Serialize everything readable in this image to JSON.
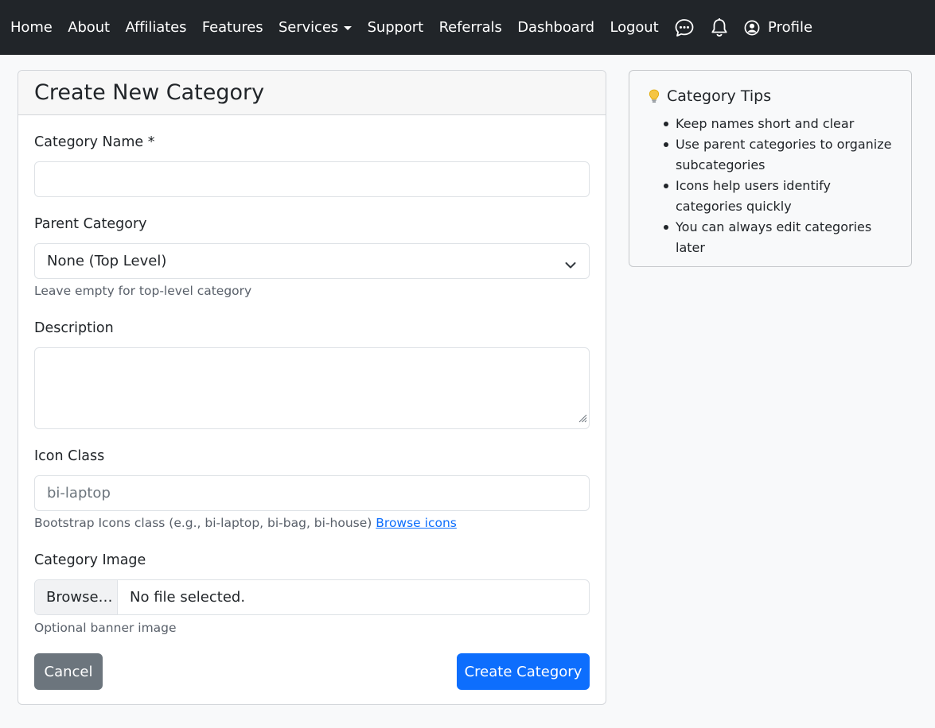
{
  "nav": {
    "items": [
      {
        "label": "Home"
      },
      {
        "label": "About"
      },
      {
        "label": "Affiliates"
      },
      {
        "label": "Features"
      },
      {
        "label": "Services"
      },
      {
        "label": "Support"
      },
      {
        "label": "Referrals"
      },
      {
        "label": "Dashboard"
      },
      {
        "label": "Logout"
      }
    ],
    "profile_label": "Profile",
    "icons": [
      "chat-dots-icon",
      "bell-icon",
      "person-circle-icon"
    ]
  },
  "form": {
    "title": "Create New Category",
    "name_label": "Category Name *",
    "name_value": "",
    "parent_label": "Parent Category",
    "parent_selected": "None (Top Level)",
    "parent_help": "Leave empty for top-level category",
    "description_label": "Description",
    "description_value": "",
    "icon_label": "Icon Class",
    "icon_placeholder": "bi-laptop",
    "icon_help": "Bootstrap Icons class (e.g., bi-laptop, bi-bag, bi-house)",
    "icon_help_link": "Browse icons",
    "image_label": "Category Image",
    "image_button": "Browse…",
    "image_status": "No file selected.",
    "image_help": "Optional banner image",
    "cancel_label": "Cancel",
    "submit_label": "Create Category"
  },
  "tips": {
    "title": "Category Tips",
    "items": [
      "Keep names short and clear",
      "Use parent categories to organize subcategories",
      "Icons help users identify categories quickly",
      "You can always edit categories later"
    ]
  },
  "colors": {
    "navbar_bg": "#212529",
    "primary": "#0d6efd",
    "secondary": "#6c757d",
    "page_bg": "#f8f9fa"
  }
}
